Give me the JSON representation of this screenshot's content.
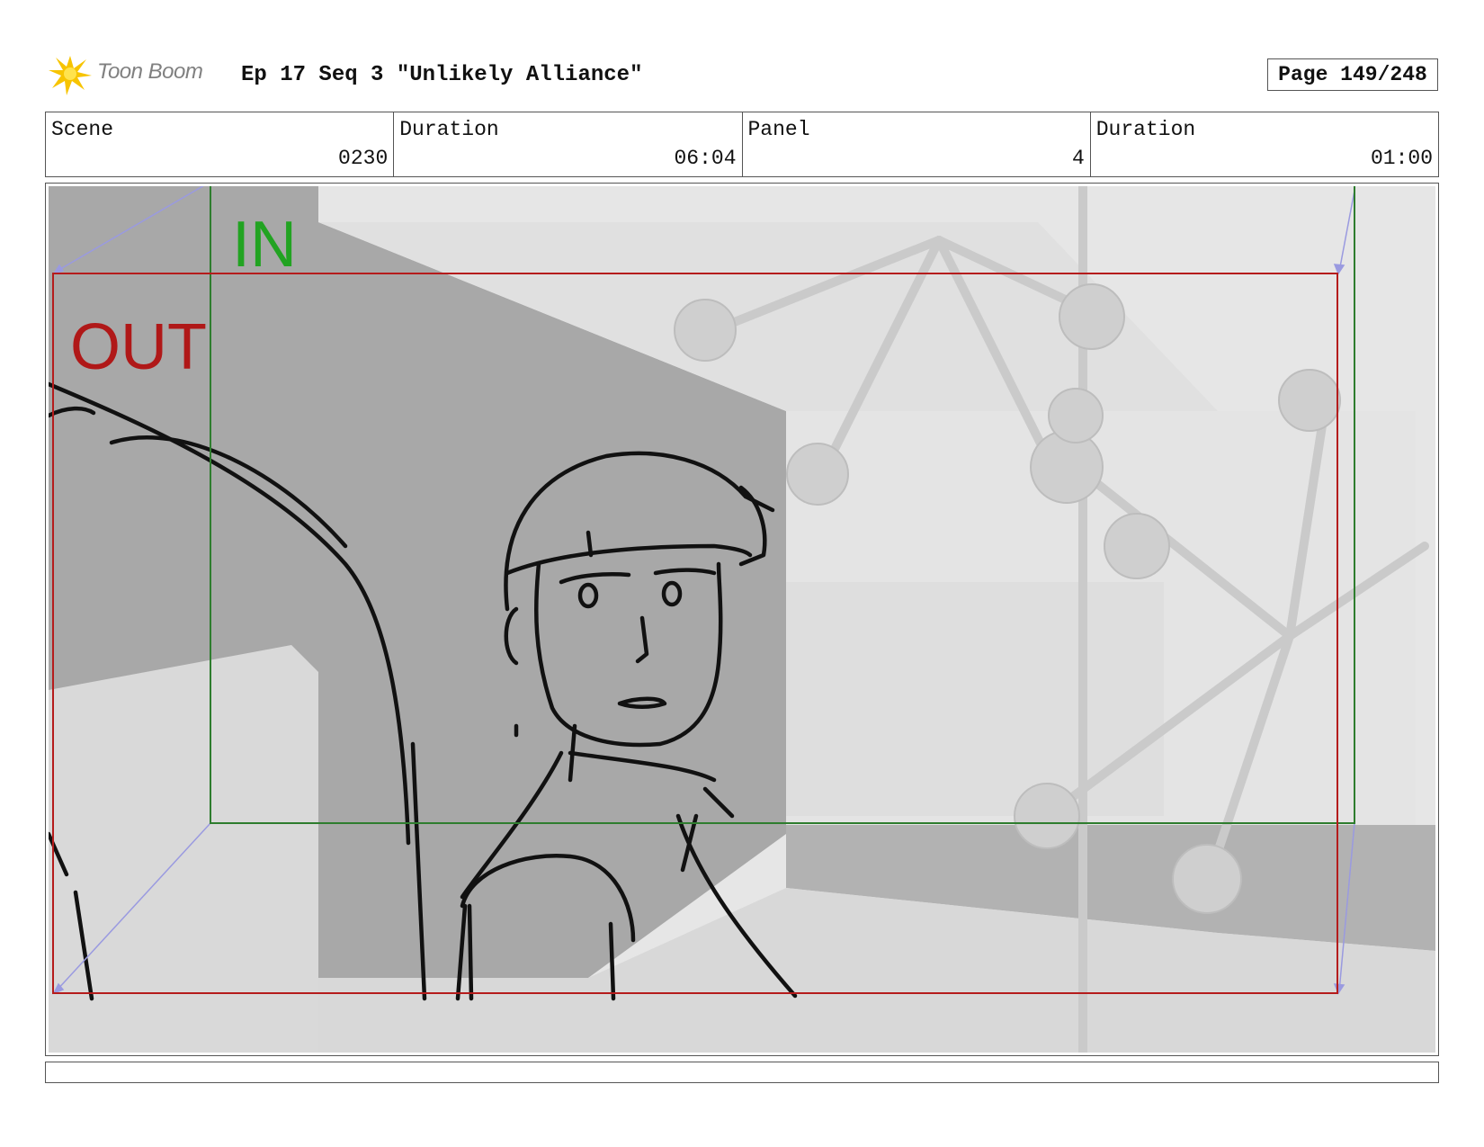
{
  "header": {
    "logo_text": "Toon Boom",
    "title": "Ep 17 Seq 3 \"Unlikely Alliance\"",
    "page": "Page 149/248"
  },
  "info": [
    {
      "label": "Scene",
      "value": "0230"
    },
    {
      "label": "Duration",
      "value": "06:04"
    },
    {
      "label": "Panel",
      "value": "4"
    },
    {
      "label": "Duration",
      "value": "01:00"
    }
  ],
  "panel": {
    "in_label": "IN",
    "out_label": "OUT",
    "colors": {
      "in_frame": "#2e7d2e",
      "out_frame": "#b51c1c",
      "camera_path": "#9a9ae0"
    }
  }
}
